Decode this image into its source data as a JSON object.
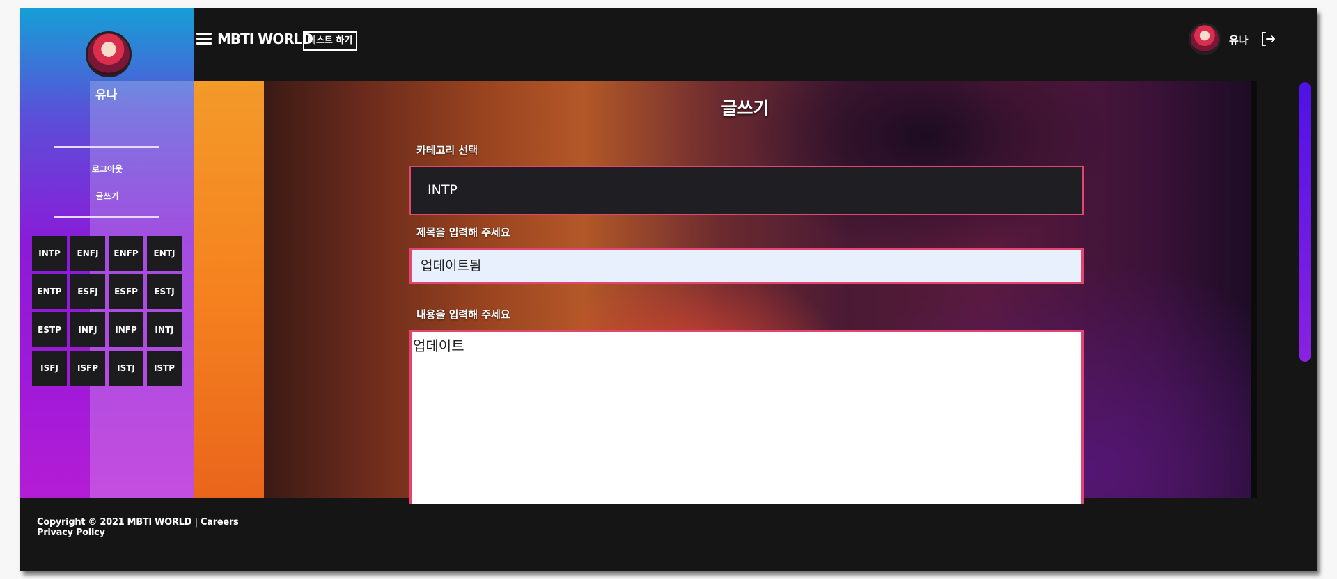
{
  "brand": {
    "name": "MBTI WORLD",
    "test_button": "테스트 하기"
  },
  "user": {
    "name": "유나"
  },
  "sidebar": {
    "user_name": "유나",
    "links": [
      {
        "label": "로그아웃"
      },
      {
        "label": "글쓰기"
      }
    ],
    "mbti_types": [
      "INTP",
      "ENFJ",
      "ENFP",
      "ENTJ",
      "ENTP",
      "ESFJ",
      "ESFP",
      "ESTJ",
      "ESTP",
      "INFJ",
      "INFP",
      "INTJ",
      "ISFJ",
      "ISFP",
      "ISTJ",
      "ISTP"
    ]
  },
  "form": {
    "page_title": "글쓰기",
    "category_label": "카테고리 선택",
    "category_value": "INTP",
    "title_label": "제목을 입력해 주세요",
    "title_value": "업데이트됨",
    "content_label": "내용을 입력해 주세요",
    "content_value": "업데이트"
  },
  "footer": {
    "copyright": "Copyright © 2021 MBTI WORLD",
    "separator": " | ",
    "careers": "Careers",
    "privacy": "Privacy Policy"
  },
  "colors": {
    "accent_border": "#e0466f",
    "scrollbar": "#5a14e6",
    "sidebar_top": "#169fd6",
    "sidebar_bottom": "#b41dd6"
  },
  "icons": [
    "menu-icon",
    "logout-icon"
  ]
}
